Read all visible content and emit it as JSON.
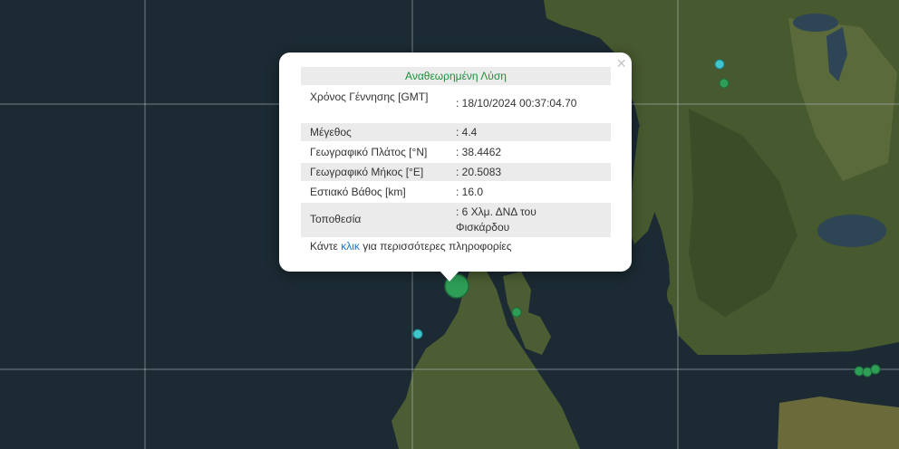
{
  "popup": {
    "title": "Αναθεωρημένη Λύση",
    "close_label": "×",
    "rows": [
      {
        "label": "Χρόνος Γέννησης [GMT]",
        "value": ": 18/10/2024 00:37:04.70"
      },
      {
        "label": "Μέγεθος",
        "value": ": 4.4"
      },
      {
        "label": "Γεωγραφικό Πλάτος [°N]",
        "value": ": 38.4462"
      },
      {
        "label": "Γεωγραφικό Μήκος [°E]",
        "value": ": 20.5083"
      },
      {
        "label": "Εστιακό Βάθος [km]",
        "value": ": 16.0"
      },
      {
        "label": "Τοποθεσία",
        "value": ": 6 Χλμ. ΔΝΔ του Φισκάρδου"
      }
    ],
    "footer_before": "Κάντε ",
    "footer_link": "κλικ",
    "footer_after": " για περισσότερες πληροφορίες"
  },
  "colors": {
    "sea": "#1b2a33",
    "land": "#47592f",
    "marker_green": "#2e9e57",
    "marker_cyan": "#3fc6cc",
    "title_green": "#1e8f3a",
    "link_blue": "#1f74c9"
  },
  "markers": [
    {
      "name": "main-event",
      "color": "green"
    },
    {
      "name": "event",
      "color": "green"
    },
    {
      "name": "event",
      "color": "cyan"
    },
    {
      "name": "event",
      "color": "cyan"
    },
    {
      "name": "event",
      "color": "green"
    },
    {
      "name": "event",
      "color": "green"
    },
    {
      "name": "event",
      "color": "green"
    },
    {
      "name": "event",
      "color": "green"
    }
  ]
}
